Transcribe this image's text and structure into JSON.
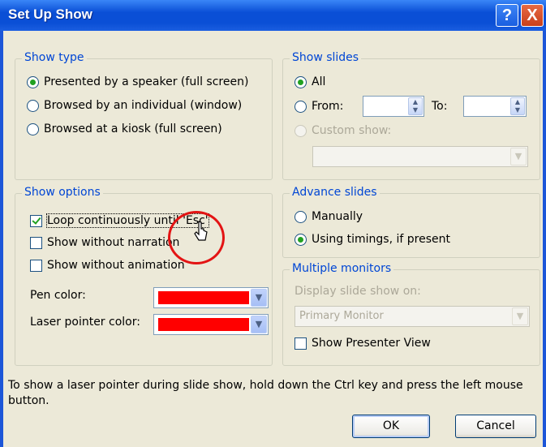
{
  "window": {
    "title": "Set Up Show",
    "help_button": "?",
    "close_button": "X"
  },
  "show_type": {
    "legend": "Show type",
    "options": [
      {
        "label": "Presented by a speaker (full screen)",
        "selected": true
      },
      {
        "label": "Browsed by an individual (window)",
        "selected": false
      },
      {
        "label": "Browsed at a kiosk (full screen)",
        "selected": false
      }
    ]
  },
  "show_slides": {
    "legend": "Show slides",
    "all_label": "All",
    "from_label": "From:",
    "to_label": "To:",
    "from_value": "",
    "to_value": "",
    "custom_show_label": "Custom show:",
    "custom_show_value": "",
    "selected": "All"
  },
  "show_options": {
    "legend": "Show options",
    "loop_label": "Loop continuously until 'Esc'",
    "loop_checked": true,
    "narration_label": "Show without narration",
    "narration_checked": false,
    "animation_label": "Show without animation",
    "animation_checked": false,
    "pen_color_label": "Pen color:",
    "pen_color": "#ff0000",
    "laser_color_label": "Laser pointer color:",
    "laser_color": "#ff0000"
  },
  "advance_slides": {
    "legend": "Advance slides",
    "manually_label": "Manually",
    "timings_label": "Using timings, if present",
    "selected": "Using timings, if present"
  },
  "multiple_monitors": {
    "legend": "Multiple monitors",
    "display_label": "Display slide show on:",
    "monitor_value": "Primary Monitor",
    "presenter_view_label": "Show Presenter View",
    "presenter_view_checked": false
  },
  "footer": {
    "hint": "To show a laser pointer during slide show, hold down the Ctrl key and press the left mouse button.",
    "ok_label": "OK",
    "cancel_label": "Cancel"
  },
  "colors": {
    "title_bar": "#0a4fd6",
    "dialog_bg": "#ece9d8",
    "group_legend": "#0046d5",
    "annotation": "#e31414"
  }
}
